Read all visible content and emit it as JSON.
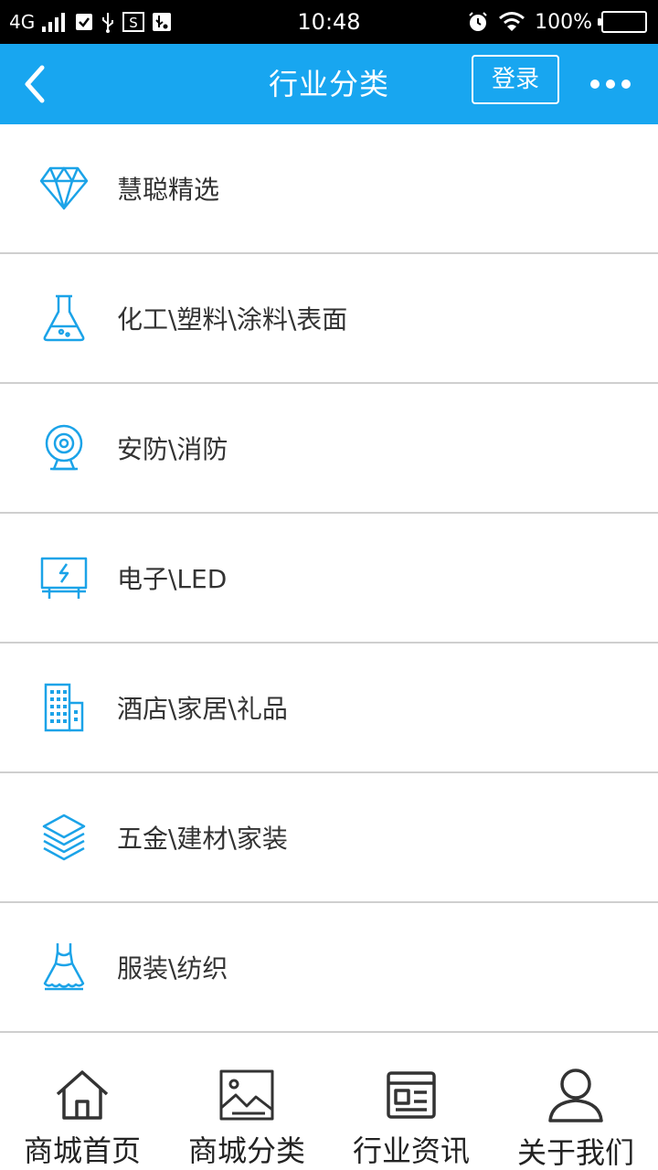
{
  "status_bar": {
    "network": "4G",
    "time": "10:48",
    "battery": "100%",
    "battery_level": 1.0
  },
  "header": {
    "title": "行业分类",
    "login_label": "登录"
  },
  "colors": {
    "accent": "#18a6f0",
    "icon": "#1ba3e8",
    "status_bar_bg": "#000000"
  },
  "categories": [
    {
      "label": "慧聪精选",
      "icon": "diamond-icon"
    },
    {
      "label": "化工\\塑料\\涂料\\表面",
      "icon": "flask-icon"
    },
    {
      "label": "安防\\消防",
      "icon": "webcam-icon"
    },
    {
      "label": "电子\\LED",
      "icon": "led-board-icon"
    },
    {
      "label": "酒店\\家居\\礼品",
      "icon": "building-icon"
    },
    {
      "label": "五金\\建材\\家装",
      "icon": "layers-icon"
    },
    {
      "label": "服装\\纺织",
      "icon": "dress-icon"
    }
  ],
  "bottom_nav": [
    {
      "label": "商城首页",
      "icon": "home-icon"
    },
    {
      "label": "商城分类",
      "icon": "image-icon"
    },
    {
      "label": "行业资讯",
      "icon": "news-icon"
    },
    {
      "label": "关于我们",
      "icon": "user-icon"
    }
  ]
}
